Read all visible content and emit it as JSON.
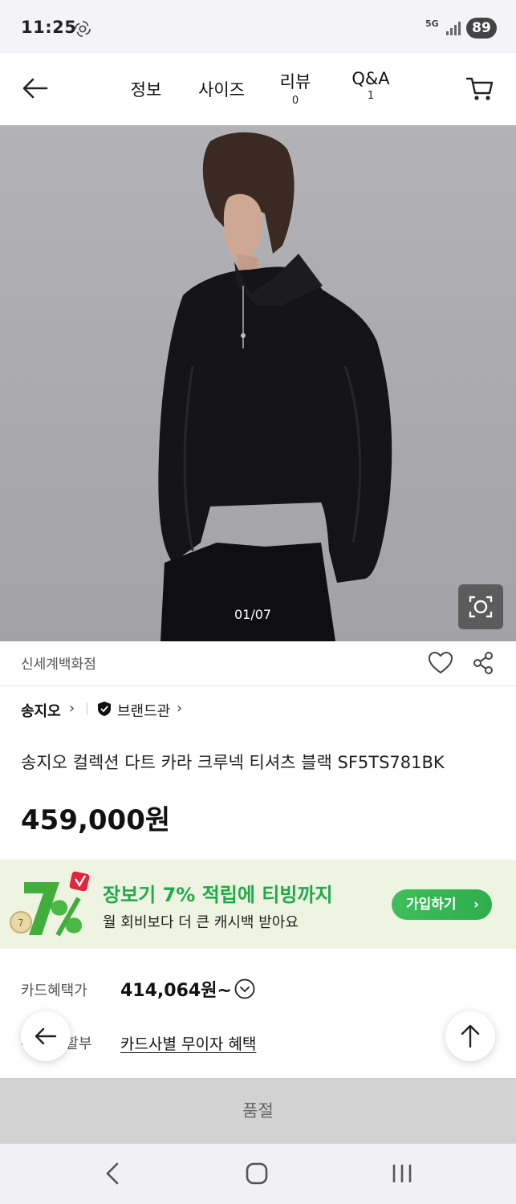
{
  "status_bar": {
    "time": "11:25",
    "network": "5G",
    "battery": "89"
  },
  "nav": {
    "tabs": [
      {
        "label": "정보",
        "count": ""
      },
      {
        "label": "사이즈",
        "count": ""
      },
      {
        "label": "리뷰",
        "count": "0"
      },
      {
        "label": "Q&A",
        "count": "1"
      }
    ]
  },
  "gallery": {
    "counter": "01/07"
  },
  "seller": {
    "name": "신세계백화점"
  },
  "brand": {
    "name": "송지오",
    "chevron": "›",
    "hall_label": "브랜드관",
    "hall_chevron": "›"
  },
  "product": {
    "title": "송지오 컬렉션 다트 카라 크루넥 티셔츠 블랙 SF5TS781BK",
    "price": "459,000원"
  },
  "promo": {
    "headline": "장보기 7% 적립에 티빙까지",
    "subtext": "월 회비보다 더 큰 캐시백 받아요",
    "join_label": "가입하기",
    "join_chevron": "›",
    "accent_color": "#1faa4a"
  },
  "card_benefit": {
    "label": "카드혜택가",
    "price": "414,064원~"
  },
  "installment": {
    "label": "무이자 할부",
    "link": "카드사별 무이자 혜택"
  },
  "purchase": {
    "status_label": "품절"
  }
}
